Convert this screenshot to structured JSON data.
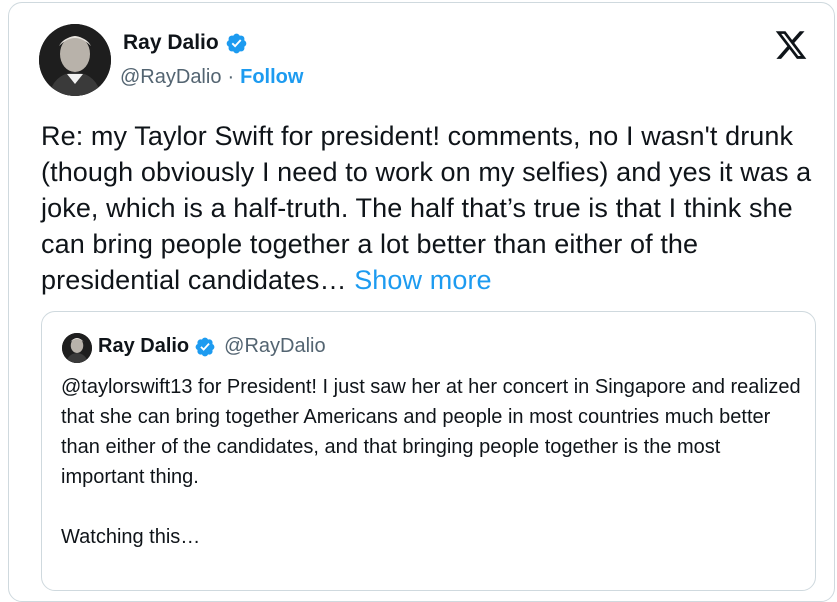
{
  "tweet": {
    "author_name": "Ray Dalio",
    "handle": "@RayDalio",
    "separator": "·",
    "follow_label": "Follow",
    "text": "Re: my Taylor Swift for president! comments, no I wasn't drunk (though obviously I need to work on my selfies) and yes it was a joke, which is a half-truth. The half that’s true is that I think she can bring people together a lot better than either of the presidential candidates…",
    "show_more_label": "Show more"
  },
  "quoted_tweet": {
    "author_name": "Ray Dalio",
    "handle": "@RayDalio",
    "text": "@taylorswift13 for President! I just saw her at her concert in Singapore and realized that she can bring together Americans and people in most countries much better than either of the candidates, and that bringing people together is the most important thing.",
    "text_2": "Watching this…"
  },
  "icons": {
    "logo": "x-logo-icon",
    "verified": "verified-badge-icon"
  },
  "colors": {
    "link": "#1d9bf0",
    "verified": "#1d9bf0",
    "secondary_text": "#536471",
    "border": "#cfd9de"
  }
}
